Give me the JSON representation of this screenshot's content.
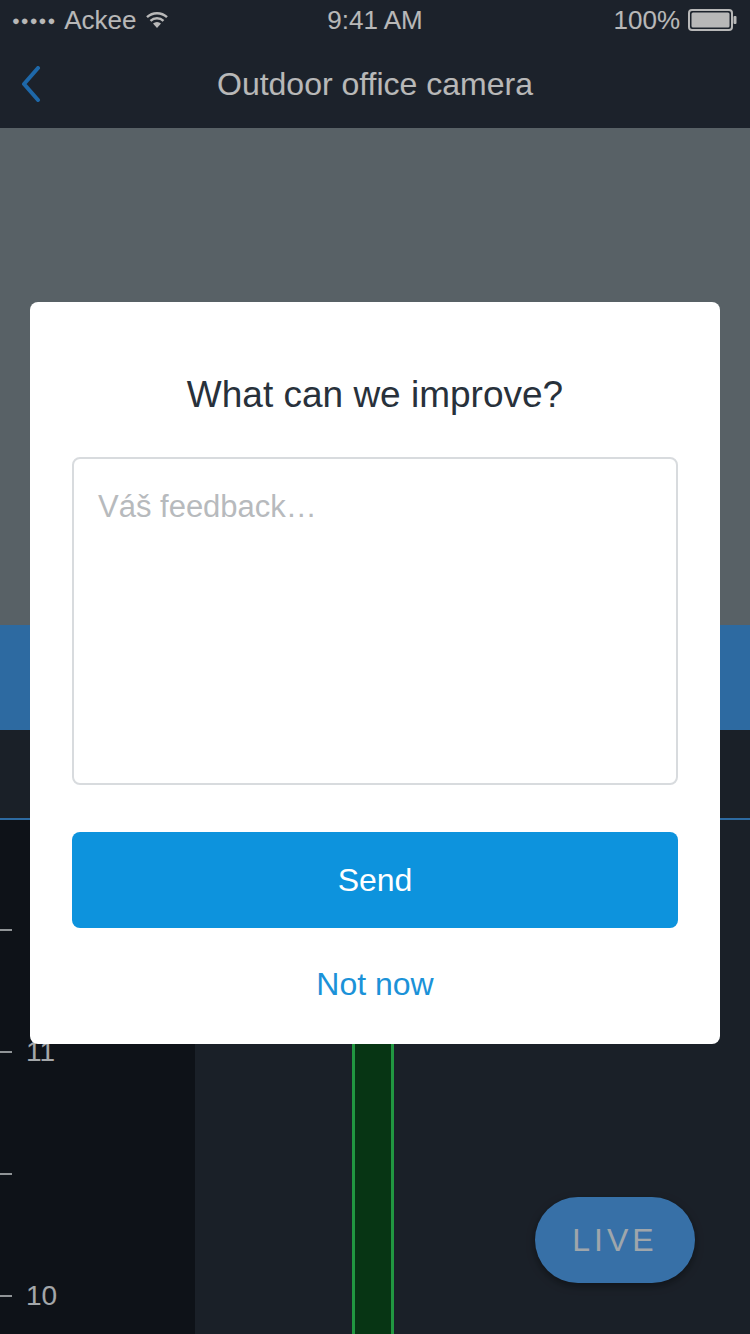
{
  "status_bar": {
    "signal": "●●●●●",
    "carrier": "Ackee",
    "time": "9:41 AM",
    "battery": "100%",
    "battery_level": 1
  },
  "nav": {
    "title": "Outdoor office camera"
  },
  "timeline": {
    "labels": [
      "11",
      "10"
    ]
  },
  "live_button": {
    "label": "LIVE"
  },
  "dialog": {
    "title": "What can we improve?",
    "placeholder": "Váš feedback…",
    "buttons": [
      "Send",
      "Not now"
    ]
  }
}
